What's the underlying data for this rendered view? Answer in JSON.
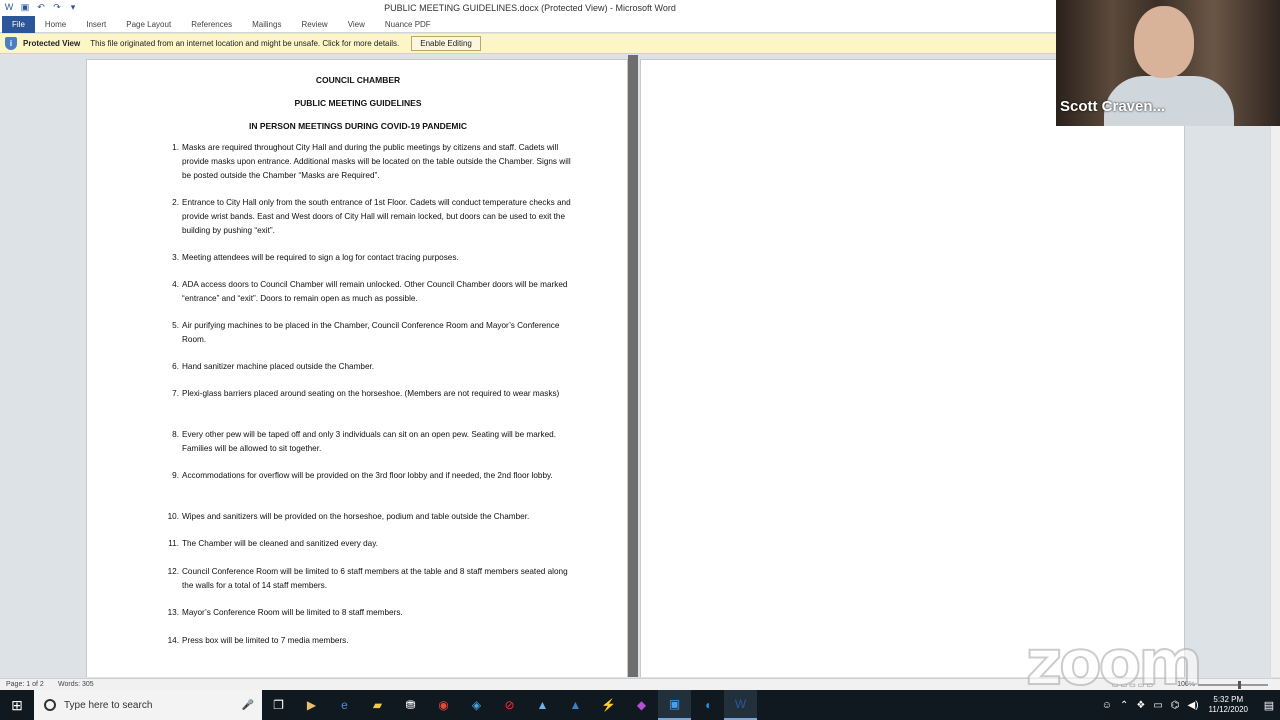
{
  "window": {
    "title": "PUBLIC MEETING GUIDELINES.docx (Protected View) - Microsoft Word"
  },
  "ribbon": {
    "tabs": [
      "File",
      "Home",
      "Insert",
      "Page Layout",
      "References",
      "Mailings",
      "Review",
      "View",
      "Nuance PDF"
    ]
  },
  "protected_view": {
    "title": "Protected View",
    "message": "This file originated from an internet location and might be unsafe. Click for more details.",
    "button": "Enable Editing"
  },
  "document": {
    "heading1": "COUNCIL CHAMBER",
    "heading2": "PUBLIC MEETING GUIDELINES",
    "heading3": "IN PERSON MEETINGS DURING COVID-19 PANDEMIC",
    "items": [
      {
        "num": "1.",
        "text": "Masks are required throughout City Hall and during the public meetings by citizens and staff. Cadets will provide masks upon entrance. Additional masks will be located on the table outside the Chamber. Signs will be posted outside the Chamber “Masks are Required”."
      },
      {
        "num": "2.",
        "text": "Entrance to City Hall only from the south entrance of 1st Floor. Cadets will conduct temperature checks and provide wrist bands. East and West doors of City Hall will remain locked, but doors can be used to exit the building by pushing “exit”."
      },
      {
        "num": "3.",
        "text": "Meeting attendees will be required to sign a log for contact tracing purposes."
      },
      {
        "num": "4.",
        "text": "ADA access doors to Council Chamber will remain unlocked. Other Council Chamber doors will be marked “entrance” and “exit”. Doors to remain open as much as possible."
      },
      {
        "num": "5.",
        "text": "Air purifying machines to be placed in the Chamber, Council Conference Room and Mayor’s Conference Room."
      },
      {
        "num": "6.",
        "text": "Hand sanitizer machine placed outside the Chamber."
      },
      {
        "num": "7.",
        "text": "Plexi-glass barriers placed around seating on the horseshoe. (Members are not required to wear masks)"
      },
      {
        "num": "8.",
        "text": "Every other pew will be taped off and only 3 individuals can sit on an open pew. Seating will be marked. Families will be allowed to sit together."
      },
      {
        "num": "9.",
        "text": "Accommodations for overflow will be provided on the 3rd floor lobby and if needed, the 2nd floor lobby."
      },
      {
        "num": "10.",
        "text": "Wipes and sanitizers will be provided on the horseshoe, podium and table outside the Chamber."
      },
      {
        "num": "11.",
        "text": "The Chamber will be cleaned and sanitized every day."
      },
      {
        "num": "12.",
        "text": "Council Conference Room will be limited to 6 staff members at the table and 8 staff members seated along the walls for a total of 14 staff members."
      },
      {
        "num": "13.",
        "text": "Mayor’s Conference Room will be limited to 8 staff members."
      },
      {
        "num": "14.",
        "text": "Press box will be limited to 7 media members."
      }
    ]
  },
  "status": {
    "page": "Page: 1 of 2",
    "words": "Words: 305",
    "zoom": "100%"
  },
  "video": {
    "participant_name": "Scott Craven..."
  },
  "watermark": "zoom",
  "taskbar": {
    "search_placeholder": "Type here to search",
    "time": "5:32 PM",
    "date": "11/12/2020",
    "icons": [
      "task-view-icon",
      "media-icon",
      "edge-icon",
      "file-explorer-icon",
      "store-icon",
      "chrome-icon",
      "app-icon",
      "blocked-app-icon",
      "app-a-icon",
      "app-a2-icon",
      "app-lightning-icon",
      "app-purple-icon",
      "zoom-icon",
      "app-blue-icon",
      "word-icon"
    ]
  },
  "colors": {
    "word_blue": "#2b579a",
    "protected_bar": "#fcf5c6",
    "taskbar": "#101820"
  }
}
